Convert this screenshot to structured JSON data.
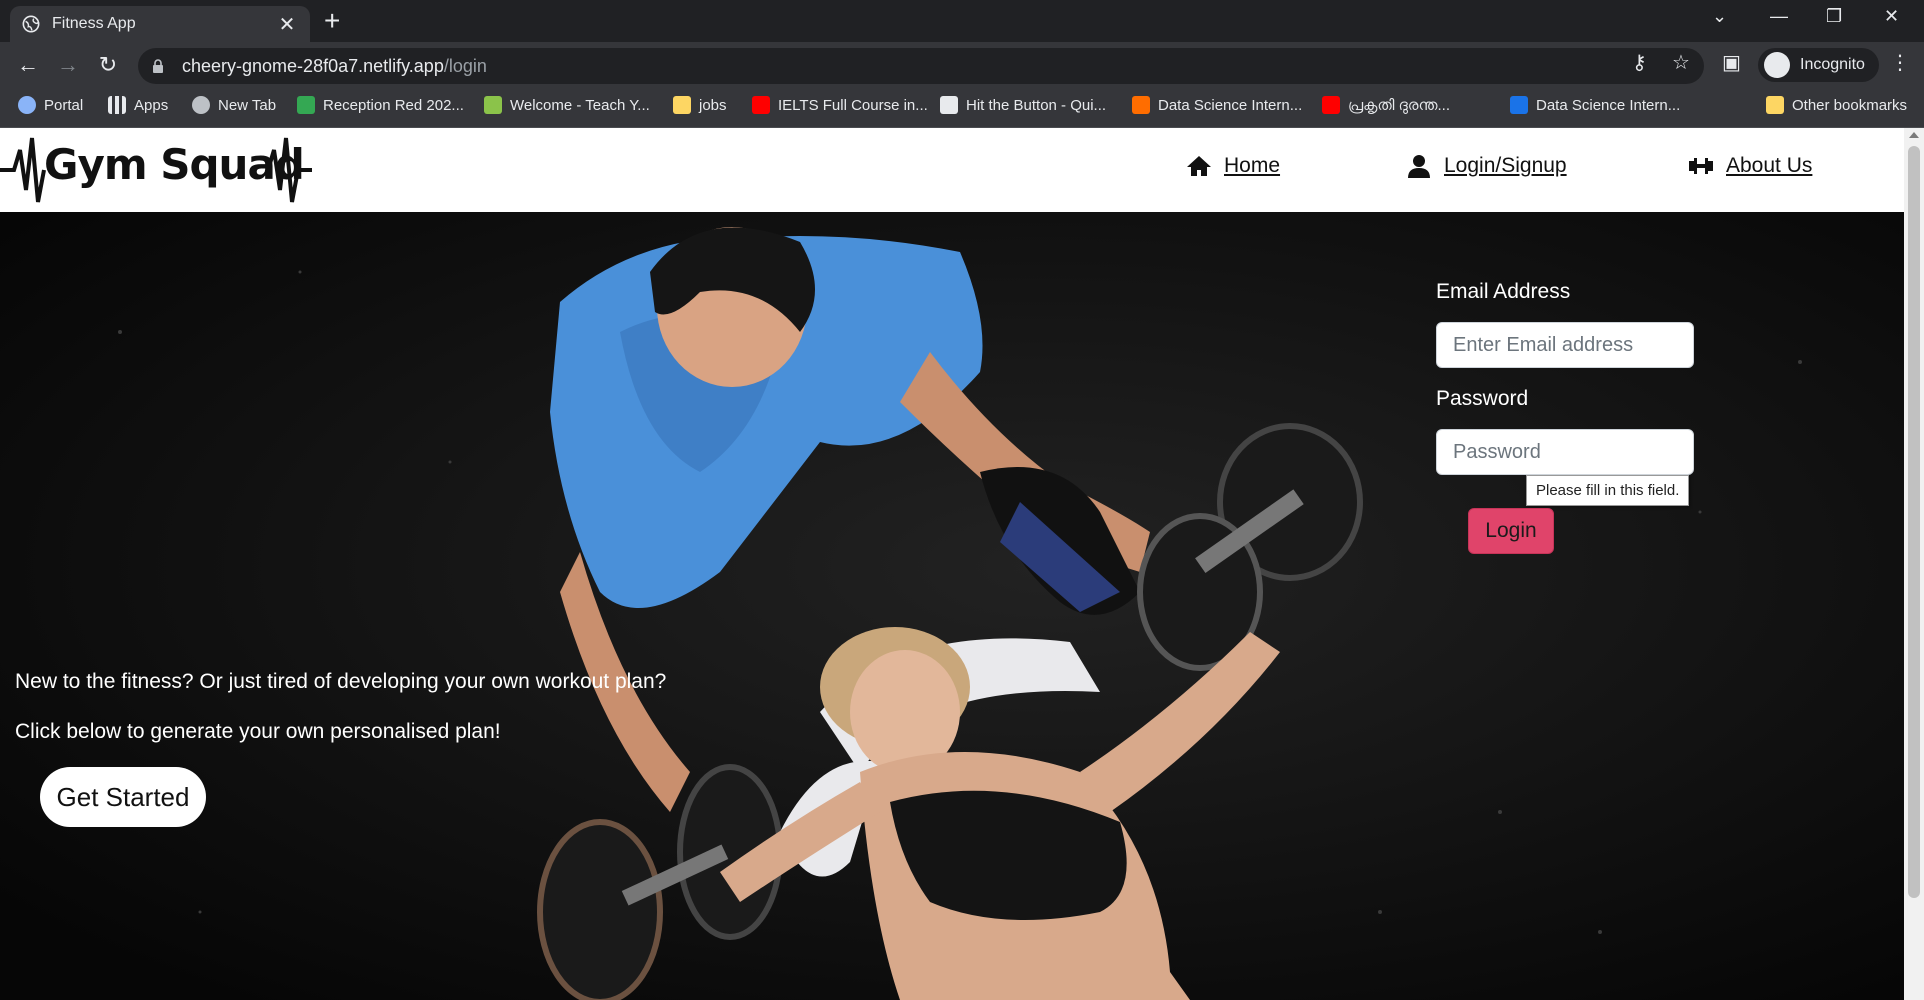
{
  "browser": {
    "tab": {
      "title": "Fitness App"
    },
    "address": {
      "host": "cheery-gnome-28f0a7.netlify.app",
      "path": "/login"
    },
    "profile_label": "Incognito",
    "bookmarks": [
      {
        "label": "Portal",
        "color": "#8ab4f8"
      },
      {
        "label": "Apps",
        "color": "#e8eaed"
      },
      {
        "label": "New Tab",
        "color": "#bdc1c6"
      },
      {
        "label": "Reception Red 202...",
        "color": "#34a853"
      },
      {
        "label": "Welcome - Teach Y...",
        "color": "#8bc34a"
      },
      {
        "label": "jobs",
        "color": "#fdd663"
      },
      {
        "label": "IELTS Full Course in...",
        "color": "#ff0000"
      },
      {
        "label": "Hit the Button - Qui...",
        "color": "#e8eaed"
      },
      {
        "label": "Data Science Intern...",
        "color": "#ff6d00"
      },
      {
        "label": "പ്രകൃതി ദുരന്ത...",
        "color": "#ff0000"
      },
      {
        "label": "Data Science Intern...",
        "color": "#1a73e8"
      }
    ],
    "other_bookmarks": "Other bookmarks"
  },
  "site": {
    "logo_text": "Gym Squad",
    "nav": [
      {
        "label": "Home",
        "icon": "home-icon"
      },
      {
        "label": "Login/Signup",
        "icon": "user-icon"
      },
      {
        "label": "About Us",
        "icon": "dumbbell-icon"
      }
    ]
  },
  "login_form": {
    "email_label": "Email Address",
    "email_placeholder": "Enter Email address",
    "password_label": "Password",
    "password_placeholder": "Password",
    "validation_tooltip": "Please fill in this field.",
    "login_button": "Login",
    "accent_color": "#e0446a"
  },
  "hero": {
    "line1": "New to the fitness? Or just tired of developing your own workout plan?",
    "line2": "Click below to generate your own personalised plan!",
    "cta": "Get Started"
  }
}
